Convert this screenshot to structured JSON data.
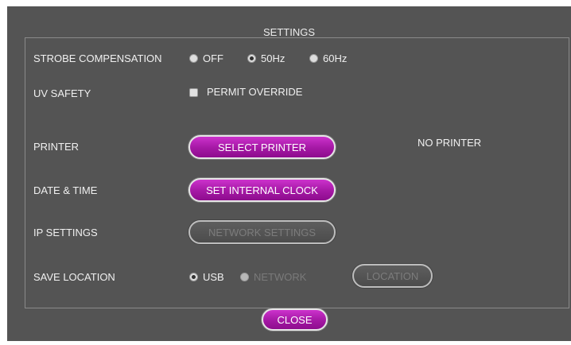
{
  "title": "SETTINGS",
  "strobe": {
    "label": "STROBE COMPENSATION",
    "options": [
      "OFF",
      "50Hz",
      "60Hz"
    ],
    "selected": "50Hz"
  },
  "uv_safety": {
    "label": "UV SAFETY",
    "checkbox_label": "PERMIT OVERRIDE",
    "checked": false
  },
  "printer": {
    "label": "PRINTER",
    "button": "SELECT PRINTER",
    "status": "NO PRINTER"
  },
  "date_time": {
    "label": "DATE & TIME",
    "button": "SET INTERNAL CLOCK"
  },
  "ip": {
    "label": "IP SETTINGS",
    "button": "NETWORK SETTINGS",
    "enabled": false
  },
  "save_location": {
    "label": "SAVE LOCATION",
    "options": [
      "USB",
      "NETWORK"
    ],
    "selected": "USB",
    "button": "LOCATION",
    "button_enabled": false
  },
  "close_button": "CLOSE",
  "colors": {
    "background": "#545454",
    "accent": "#b020b0",
    "text": "#f0f0f0",
    "disabled_text": "#7a7a7a"
  }
}
